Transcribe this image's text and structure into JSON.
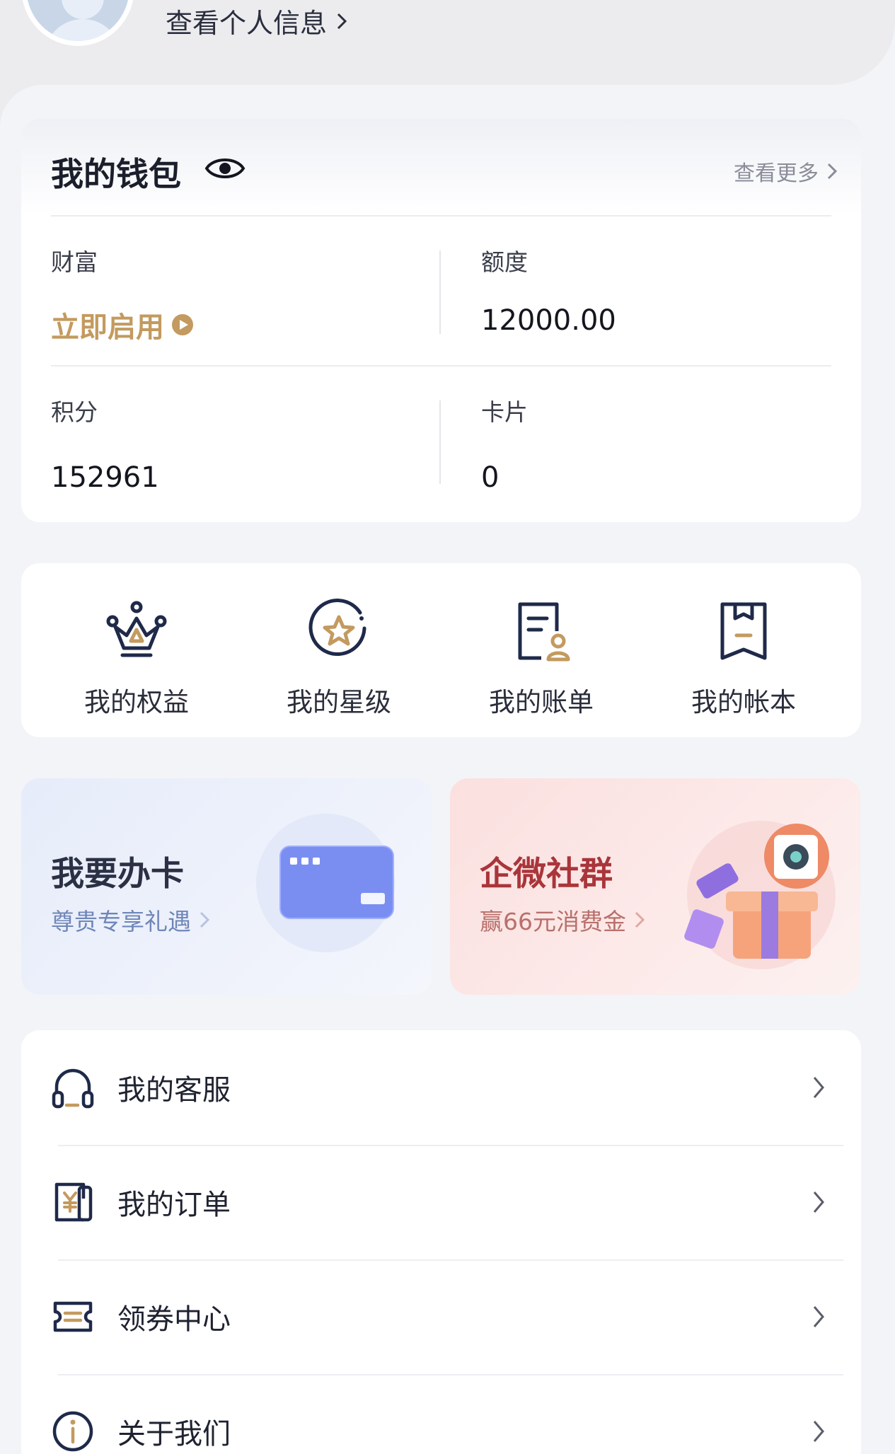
{
  "header": {
    "profile_link": "查看个人信息"
  },
  "wallet": {
    "title": "我的钱包",
    "more": "查看更多",
    "cells": [
      {
        "label": "财富",
        "value": "立即启用"
      },
      {
        "label": "额度",
        "value": "12000.00"
      },
      {
        "label": "积分",
        "value": "152961"
      },
      {
        "label": "卡片",
        "value": "0"
      }
    ]
  },
  "quick": [
    {
      "label": "我的权益",
      "icon": "crown-icon"
    },
    {
      "label": "我的星级",
      "icon": "star-badge-icon"
    },
    {
      "label": "我的账单",
      "icon": "bill-icon"
    },
    {
      "label": "我的帐本",
      "icon": "ledger-icon"
    }
  ],
  "promos": [
    {
      "title": "我要办卡",
      "subtitle": "尊贵专享礼遇",
      "title_color": "#2b3045",
      "subtitle_color": "#6f86b8"
    },
    {
      "title": "企微社群",
      "subtitle": "赢66元消费金",
      "title_color": "#a9353a",
      "subtitle_color": "#b8706b"
    }
  ],
  "menu": [
    {
      "label": "我的客服",
      "icon": "headset-icon"
    },
    {
      "label": "我的订单",
      "icon": "order-icon"
    },
    {
      "label": "领券中心",
      "icon": "coupon-icon"
    },
    {
      "label": "关于我们",
      "icon": "info-icon"
    }
  ],
  "colors": {
    "gold": "#c39a5f",
    "navy": "#1f2a4a",
    "accent_blue": "#6b82f0"
  }
}
